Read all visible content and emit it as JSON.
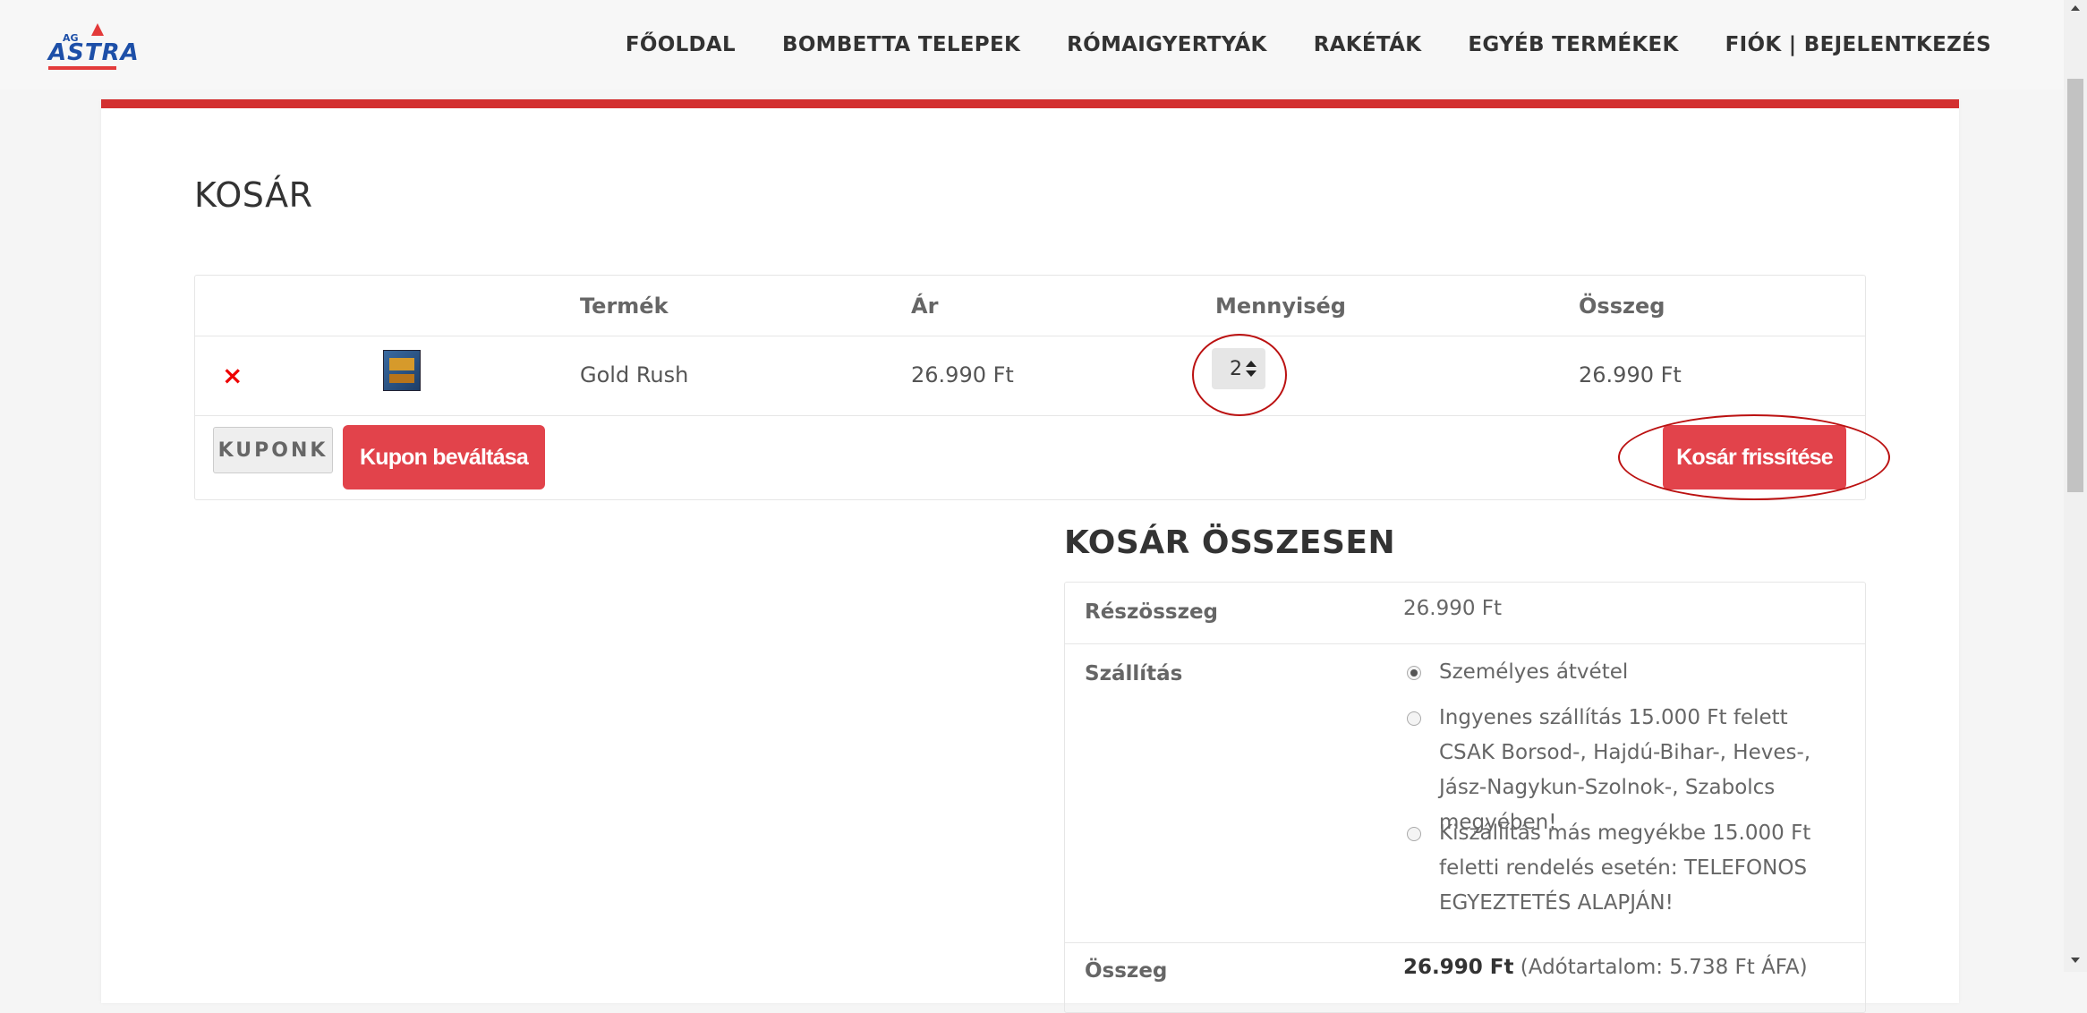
{
  "header": {
    "logo_small": "AG",
    "logo_text": "ASTRA",
    "nav": [
      "FŐOLDAL",
      "BOMBETTA TELEPEK",
      "RÓMAIGYERTYÁK",
      "RAKÉTÁK",
      "EGYÉB TERMÉKEK",
      "FIÓK | BEJELENTKEZÉS"
    ]
  },
  "page_title": "KOSÁR",
  "cart": {
    "columns": [
      "Termék",
      "Ár",
      "Mennyiség",
      "Összeg"
    ],
    "items": [
      {
        "remove": "×",
        "product": "Gold Rush",
        "price": "26.990 Ft",
        "quantity": "2",
        "subtotal": "26.990 Ft"
      }
    ],
    "coupon_placeholder": "KUPONK",
    "apply_coupon": "Kupon beváltása",
    "update_cart": "Kosár frissítése"
  },
  "totals": {
    "title": "KOSÁR ÖSSZESEN",
    "subtotal_label": "Részösszeg",
    "subtotal_value": "26.990 Ft",
    "shipping_label": "Szállítás",
    "shipping_options": [
      {
        "label": "Személyes átvétel",
        "checked": true
      },
      {
        "label": "Ingyenes szállítás 15.000 Ft felett CSAK Borsod-, Hajdú-Bihar-, Heves-, Jász-Nagykun-Szolnok-, Szabolcs megyében!",
        "checked": false
      },
      {
        "label": "Kiszállítás más megyékbe 15.000 Ft feletti rendelés esetén: TELEFONOS EGYEZTETÉS ALAPJÁN!",
        "checked": false
      }
    ],
    "total_label": "Összeg",
    "total_value": "26.990 Ft",
    "total_tax": "(Adótartalom: 5.738 Ft ÁFA)"
  },
  "colors": {
    "accent": "#d32f2f",
    "button": "#e2434b",
    "annotation": "#bb1111"
  }
}
